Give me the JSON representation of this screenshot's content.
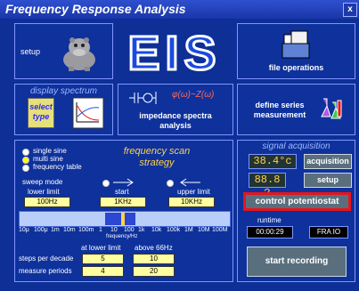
{
  "app": {
    "title": "Frequency Response Analysis",
    "close_label": "x"
  },
  "setup": {
    "label": "setup"
  },
  "eis_logo": "EIS",
  "file_ops": {
    "label": "file operations"
  },
  "display_spectrum": {
    "title": "display spectrum",
    "select_type_label": "select type"
  },
  "impedance": {
    "label": "impedance spectra analysis",
    "formula": "φ(ω)~Z(ω)"
  },
  "define_series": {
    "label": "define series measurement"
  },
  "scan": {
    "modes": [
      "single sine",
      "multi sine",
      "frequency table"
    ],
    "title": "frequency scan strategy",
    "sweep_mode_label": "sweep mode",
    "lower_limit_label": "lower limit",
    "start_label": "start",
    "upper_limit_label": "upper limit",
    "lower_limit_value": "100Hz",
    "start_value": "1KHz",
    "upper_limit_value": "10KHz",
    "ticks": [
      "10μ",
      "100μ",
      "1m",
      "10m",
      "100m",
      "1",
      "10",
      "100",
      "1k",
      "10k",
      "100k",
      "1M",
      "10M",
      "100M"
    ],
    "axis_unit": "frequency/Hz",
    "at_lower_limit_label": "at lower limit",
    "above_label": "above 66Hz",
    "steps_label": "steps per decade",
    "steps_lower": "5",
    "steps_above": "10",
    "periods_label": "measure periods",
    "periods_lower": "4",
    "periods_above": "20"
  },
  "acq": {
    "title": "signal acquisition",
    "temp": "38.4°c",
    "status": "88.8 ?",
    "acquisition_label": "acquisition",
    "setup_label": "setup",
    "control_pot_label": "control potentiostat",
    "runtime_label": "runtime",
    "runtime_value": "00:00:29",
    "fra_label": "FRA IO",
    "start_recording_label": "start recording"
  },
  "colors": {
    "accent_red": "#e8141b",
    "panel_blue": "#0e319c",
    "lcd_yellow": "#ffd24a"
  }
}
